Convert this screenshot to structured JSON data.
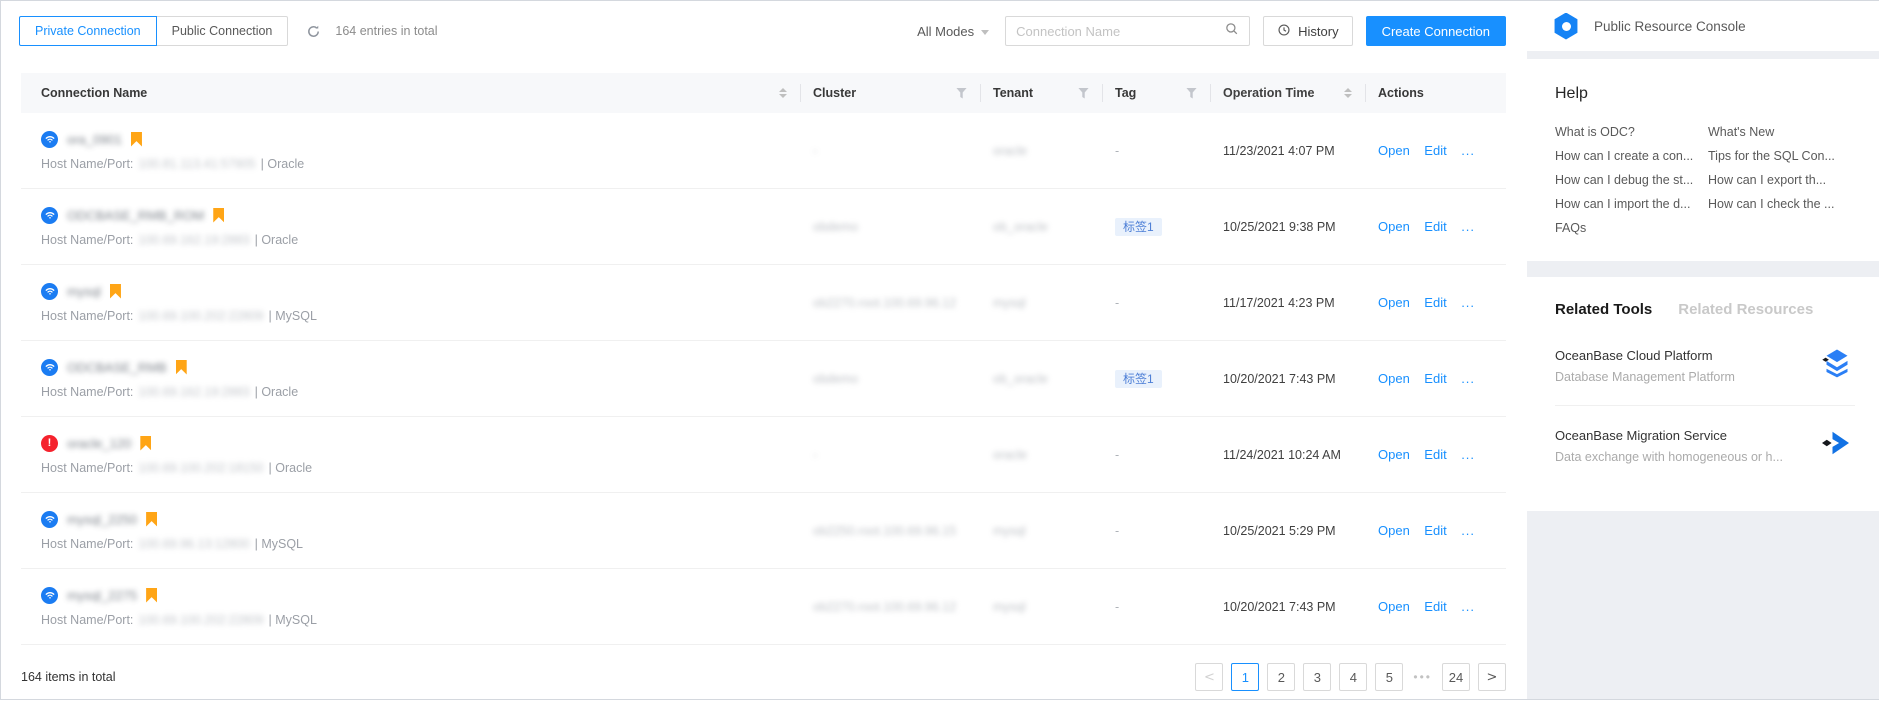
{
  "toolbar": {
    "tabs": {
      "private": "Private Connection",
      "public": "Public Connection"
    },
    "entries_total": "164 entries in total",
    "mode_filter": "All Modes",
    "search_placeholder": "Connection Name",
    "history_label": "History",
    "create_label": "Create Connection"
  },
  "table": {
    "columns": {
      "name": "Connection Name",
      "cluster": "Cluster",
      "tenant": "Tenant",
      "tag": "Tag",
      "time": "Operation Time",
      "actions": "Actions"
    },
    "host_label": "Host Name/Port:",
    "actions": {
      "open": "Open",
      "edit": "Edit",
      "more": "..."
    },
    "rows": [
      {
        "status": "ok",
        "name": "ora_0901",
        "host": "100.81.113.41:57905",
        "db": "| Oracle",
        "cluster": "-",
        "tenant": "oracle",
        "tag": "-",
        "tag_chip": false,
        "time": "11/23/2021 4:07 PM"
      },
      {
        "status": "ok",
        "name": "ODCBASE_RMB_ROM",
        "host": "100.69.162.19:2883",
        "db": "| Oracle",
        "cluster": "obdemo",
        "tenant": "ob_oracle",
        "tag": "标签1",
        "tag_chip": true,
        "time": "10/25/2021 9:38 PM"
      },
      {
        "status": "ok",
        "name": "mysql",
        "host": "100.69.100.202:22809",
        "db": "| MySQL",
        "cluster": "ob2270.root.100.69.96.12",
        "tenant": "mysql",
        "tag": "-",
        "tag_chip": false,
        "time": "11/17/2021 4:23 PM"
      },
      {
        "status": "ok",
        "name": "ODCBASE_RMB",
        "host": "100.69.162.19:2883",
        "db": "| Oracle",
        "cluster": "obdemo",
        "tenant": "ob_oracle",
        "tag": "标签1",
        "tag_chip": true,
        "time": "10/20/2021 7:43 PM"
      },
      {
        "status": "error",
        "name": "oracle_120",
        "host": "100.69.100.202:18150",
        "db": "| Oracle",
        "cluster": "-",
        "tenant": "oracle",
        "tag": "-",
        "tag_chip": false,
        "time": "11/24/2021 10:24 AM"
      },
      {
        "status": "ok",
        "name": "mysql_2250",
        "host": "100.69.96.13:12800",
        "db": "| MySQL",
        "cluster": "ob2250.root.100.69.96.15",
        "tenant": "mysql",
        "tag": "-",
        "tag_chip": false,
        "time": "10/25/2021 5:29 PM"
      },
      {
        "status": "ok",
        "name": "mysql_2275",
        "host": "100.69.100.202:22809",
        "db": "| MySQL",
        "cluster": "ob2270.root.100.69.96.12",
        "tenant": "mysql",
        "tag": "-",
        "tag_chip": false,
        "time": "10/20/2021 7:43 PM"
      }
    ]
  },
  "pagination": {
    "total": "164 items in total",
    "prev": "<",
    "next": ">",
    "pages": [
      "1",
      "2",
      "3",
      "4",
      "5"
    ],
    "active": "1",
    "ellipsis": "•••",
    "last": "24"
  },
  "side": {
    "console_title": "Public Resource Console",
    "help": {
      "title": "Help",
      "col1": [
        "What is ODC?",
        "How can I create a con...",
        "How can I debug the st...",
        "How can I import the d...",
        "FAQs"
      ],
      "col2": [
        "What's New",
        "Tips for the SQL Con...",
        "How can I export th...",
        "How can I check the ..."
      ]
    },
    "related": {
      "tab_tools": "Related Tools",
      "tab_resources": "Related Resources",
      "items": [
        {
          "title": "OceanBase Cloud Platform",
          "desc": "Database Management Platform"
        },
        {
          "title": "OceanBase Migration Service",
          "desc": "Data exchange with homogeneous or h..."
        }
      ]
    }
  },
  "colors": {
    "primary": "#1890ff",
    "bookmark_orange": "#ffa516",
    "error_red": "#f5222d",
    "header_bg": "#f7f8fa",
    "side_bg": "#edeff3",
    "tag_bg": "#e9f1fc",
    "tag_text": "#4d7fd6"
  }
}
